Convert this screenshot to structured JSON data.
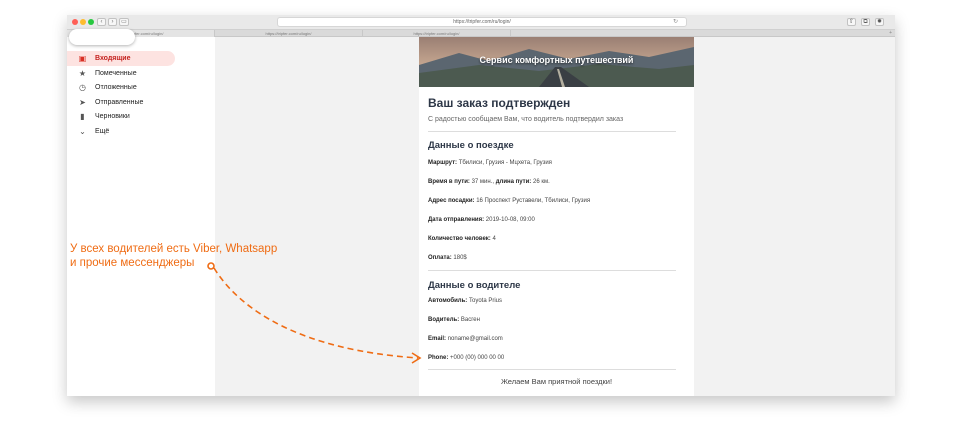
{
  "browser": {
    "url": "https://tripfer.com/ru/login/",
    "tabs": [
      {
        "label": "https://tripfer.com/ru/login/"
      },
      {
        "label": "https://tripfer.com/ru/login/"
      },
      {
        "label": "https://tripfer.com/ru/login/"
      }
    ]
  },
  "sidebar": {
    "items": [
      {
        "label": "Входящие",
        "icon": "inbox-icon"
      },
      {
        "label": "Помеченные",
        "icon": "star-icon"
      },
      {
        "label": "Отложенные",
        "icon": "clock-icon"
      },
      {
        "label": "Отправленные",
        "icon": "send-icon"
      },
      {
        "label": "Черновики",
        "icon": "draft-icon"
      },
      {
        "label": "Ещё",
        "icon": "chevron-down-icon"
      }
    ]
  },
  "email": {
    "hero_title": "Сервис комфортных путешествий",
    "title": "Ваш заказ подтвержден",
    "subtitle": "С радостью сообщаем Вам, что водитель подтвердил заказ",
    "trip_heading": "Данные о поездке",
    "trip": {
      "route_label": "Маршрут:",
      "route_value": "Тбилиси, Грузия - Мцхета, Грузия",
      "time_label": "Время в пути:",
      "time_value": "37 мин.,",
      "distance_label": "длина пути:",
      "distance_value": "26 км.",
      "pickup_label": "Адрес посадки:",
      "pickup_value": "16 Проспект Руставели, Тбилиси, Грузия",
      "date_label": "Дата отправления:",
      "date_value": "2019-10-08, 09:00",
      "people_label": "Количество человек:",
      "people_value": "4",
      "payment_label": "Оплата:",
      "payment_value": "180$"
    },
    "driver_heading": "Данные о водителе",
    "driver": {
      "car_label": "Автомобиль:",
      "car_value": "Toyota Prius",
      "driver_label": "Водитель:",
      "driver_value": "Васген",
      "email_label": "Email:",
      "email_value": "noname@gmail.com",
      "phone_label": "Phone:",
      "phone_value": "+000 (00) 000 00 00"
    },
    "closing": "Желаем Вам приятной поездки!"
  },
  "annotation": {
    "line1": "У всех водителей есть Viber, Whatsapp",
    "line2": "и прочие мессенджеры",
    "color": "#ef6c14"
  }
}
